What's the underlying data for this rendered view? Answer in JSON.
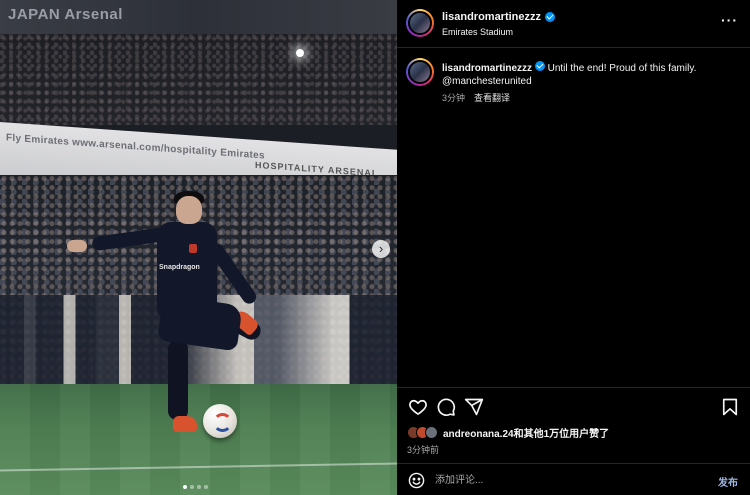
{
  "photo": {
    "banner_text": "JAPAN  Arsenal",
    "ad_board_text": "Fly Emirates   www.arsenal.com/hospitality   Emirates",
    "hospitality_text": "HOSPITALITY ARSENAL",
    "sponsor_text": "Snapdragon",
    "next_icon": "chevron-right-icon",
    "carousel_dots": 4,
    "active_dot": 1
  },
  "header": {
    "username": "lisandromartinezzz",
    "location": "Emirates Stadium",
    "more_label": "···"
  },
  "caption": {
    "username": "lisandromartinezzz",
    "text": "Until the end! Proud of this family.",
    "mention": "@manchesterunited",
    "time": "3分钟",
    "translate_label": "查看翻译"
  },
  "actions": {
    "like_icon": "heart-icon",
    "comment_icon": "comment-icon",
    "share_icon": "share-icon",
    "save_icon": "bookmark-icon"
  },
  "likes": {
    "text": "andreonana.24和其他1万位用户赞了",
    "time": "3分钟前"
  },
  "comment": {
    "placeholder": "添加评论...",
    "post_label": "发布"
  },
  "colors": {
    "background": "#000000",
    "verified": "#0095f6",
    "post_button": "#9fb7e6",
    "secondary_text": "#a8a8a8"
  }
}
